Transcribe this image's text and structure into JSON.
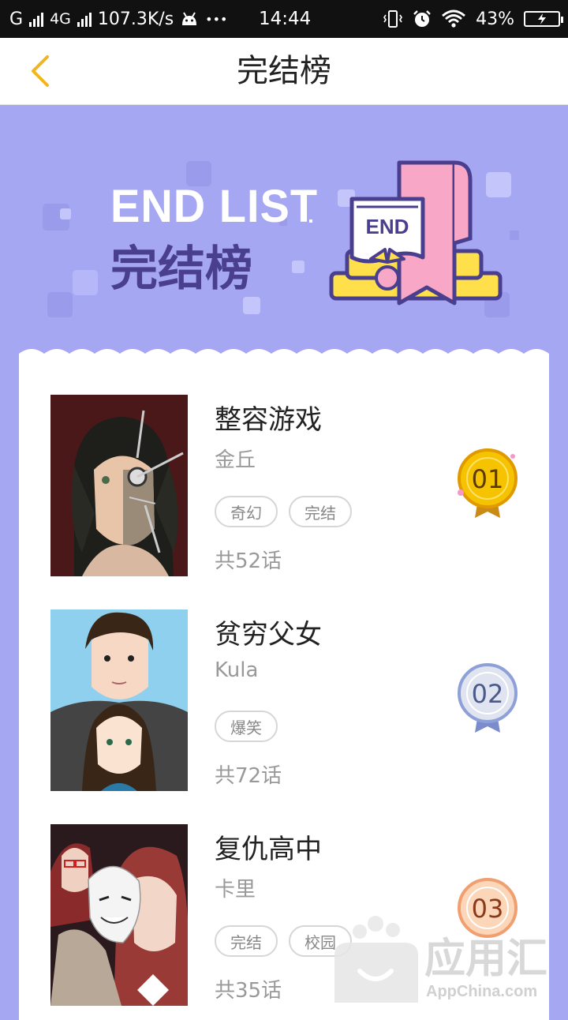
{
  "status_bar": {
    "carrier": "G",
    "network": "4G",
    "speed": "107.3K/s",
    "dots": "•••",
    "time": "14:44",
    "battery": "43%"
  },
  "header": {
    "title": "完结榜"
  },
  "banner": {
    "en_title": "END LIST",
    "cn_title": "完结榜",
    "badge_text": "END"
  },
  "list": [
    {
      "title": "整容游戏",
      "author": "金丘",
      "tags": [
        "奇幻",
        "完结"
      ],
      "episodes": "共52话",
      "rank": "01"
    },
    {
      "title": "贫穷父女",
      "author": "Kula",
      "tags": [
        "爆笑"
      ],
      "episodes": "共72话",
      "rank": "02"
    },
    {
      "title": "复仇高中",
      "author": "卡里",
      "tags": [
        "完结",
        "校园"
      ],
      "episodes": "共35话",
      "rank": "03"
    }
  ],
  "watermark": {
    "cn": "应用汇",
    "en": "AppChina.com"
  },
  "colors": {
    "banner_bg": "#a6a7f3",
    "gold": "#f5b500",
    "silver": "#8ea0d8",
    "bronze": "#f0a070"
  }
}
